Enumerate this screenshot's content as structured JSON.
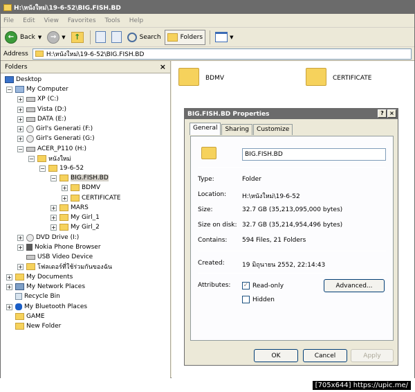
{
  "window": {
    "title": "H:\\หนังใหม่\\19-6-52\\BIG.FISH.BD"
  },
  "menu": [
    "File",
    "Edit",
    "View",
    "Favorites",
    "Tools",
    "Help"
  ],
  "toolbar": {
    "back_label": "Back",
    "search_label": "Search",
    "folders_label": "Folders"
  },
  "address": {
    "label": "Address",
    "value": "H:\\หนังใหม่\\19-6-52\\BIG.FISH.BD"
  },
  "folders_panel": {
    "title": "Folders",
    "close": "×",
    "items": [
      {
        "label": "Desktop",
        "icon": "desktop-icon"
      },
      {
        "label": "My Computer",
        "icon": "computer-icon"
      },
      {
        "label": "XP (C:)",
        "icon": "drive-icon"
      },
      {
        "label": "Vista (D:)",
        "icon": "drive-icon"
      },
      {
        "label": "DATA (E:)",
        "icon": "drive-icon"
      },
      {
        "label": "Girl's Generati (F:)",
        "icon": "disc-icon"
      },
      {
        "label": "Girl's Generati (G:)",
        "icon": "disc-icon"
      },
      {
        "label": "ACER_P110 (H:)",
        "icon": "drive-icon"
      },
      {
        "label": "หนังใหม่",
        "icon": "folder-icon"
      },
      {
        "label": "19-6-52",
        "icon": "folder-icon"
      },
      {
        "label": "BIG.FISH.BD",
        "icon": "folder-icon"
      },
      {
        "label": "BDMV",
        "icon": "folder-icon"
      },
      {
        "label": "CERTIFICATE",
        "icon": "folder-icon"
      },
      {
        "label": "MARS",
        "icon": "folder-icon"
      },
      {
        "label": "My Girl_1",
        "icon": "folder-icon"
      },
      {
        "label": "My Girl_2",
        "icon": "folder-icon"
      },
      {
        "label": "DVD Drive (I:)",
        "icon": "disc-icon"
      },
      {
        "label": "Nokia Phone Browser",
        "icon": "phone-icon"
      },
      {
        "label": "USB Video Device",
        "icon": "camera-icon"
      },
      {
        "label": "โฟลเดอร์ที่ใช้ร่วมกันของฉัน",
        "icon": "shared-folder-icon"
      },
      {
        "label": "My Documents",
        "icon": "folder-icon"
      },
      {
        "label": "My Network Places",
        "icon": "network-icon"
      },
      {
        "label": "Recycle Bin",
        "icon": "recycle-bin-icon"
      },
      {
        "label": "My Bluetooth Places",
        "icon": "bluetooth-icon"
      },
      {
        "label": "GAME",
        "icon": "folder-icon"
      },
      {
        "label": "New Folder",
        "icon": "folder-icon"
      }
    ]
  },
  "content": {
    "items": [
      {
        "label": "BDMV"
      },
      {
        "label": "CERTIFICATE"
      }
    ]
  },
  "dialog": {
    "title": "BIG.FISH.BD Properties",
    "help_btn": "?",
    "close_btn": "×",
    "tabs": [
      "General",
      "Sharing",
      "Customize"
    ],
    "name_value": "BIG.FISH.BD",
    "rows": [
      {
        "label": "Type:",
        "value": "Folder"
      },
      {
        "label": "Location:",
        "value": "H:\\หนังใหม่\\19-6-52"
      },
      {
        "label": "Size:",
        "value": "32.7 GB (35,213,095,000 bytes)"
      },
      {
        "label": "Size on disk:",
        "value": "32.7 GB (35,214,954,496 bytes)"
      },
      {
        "label": "Contains:",
        "value": "594 Files, 21 Folders"
      }
    ],
    "created_label": "Created:",
    "created_value": "19 มิถุนายน 2552, 22:14:43",
    "attributes_label": "Attributes:",
    "readonly_label": "Read-only",
    "hidden_label": "Hidden",
    "advanced_btn": "Advanced...",
    "ok_btn": "OK",
    "cancel_btn": "Cancel",
    "apply_btn": "Apply"
  },
  "watermark": "[705x644] https://upic.me/"
}
